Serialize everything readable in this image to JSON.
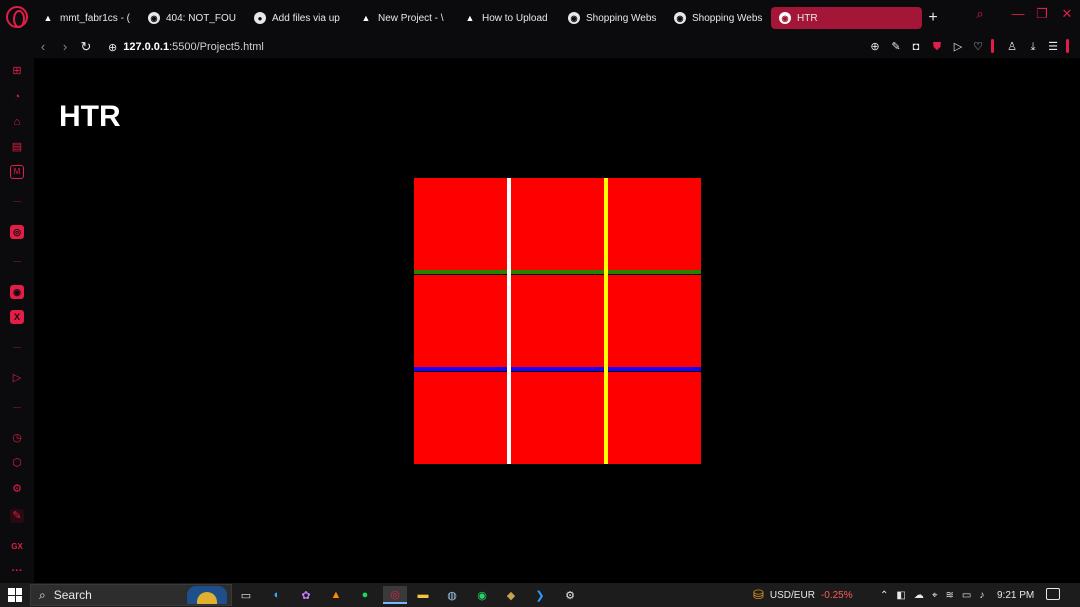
{
  "browser": {
    "tabs": [
      {
        "label": "mmt_fabr1cs - (",
        "icon": "triangle-icon"
      },
      {
        "label": "404: NOT_FOU",
        "icon": "globe-icon"
      },
      {
        "label": "Add files via up",
        "icon": "github-icon"
      },
      {
        "label": "New Project - \\",
        "icon": "triangle-icon"
      },
      {
        "label": "How to Upload",
        "icon": "triangle-icon"
      },
      {
        "label": "Shopping Webs",
        "icon": "globe-icon"
      },
      {
        "label": "Shopping Webs",
        "icon": "globe-icon"
      },
      {
        "label": "HTR",
        "icon": "globe-icon",
        "active": true
      }
    ],
    "address": {
      "host": "127.0.0.1",
      "path": ":5500/Project5.html"
    },
    "accent_color": "#e11d48"
  },
  "page": {
    "title": "HTR",
    "cube": {
      "face_color": "#ff0000",
      "grid": "3x3",
      "vertical_seams": [
        "#ffffff",
        "#ffff00"
      ],
      "horizontal_seams": [
        "#2a8000",
        "#1a00ff"
      ]
    }
  },
  "sidebar": {
    "icons": [
      "gamepad-icon",
      "speedometer-icon",
      "shopping-bag-icon",
      "tv-icon",
      "music-icon",
      "instagram-icon",
      "messenger-icon",
      "x-twitter-icon",
      "send-icon",
      "clock-icon",
      "cube-icon",
      "settings-icon",
      "pen-icon",
      "gx-icon",
      "more-icon"
    ],
    "gx_label": "GX",
    "x_label": "X",
    "more_label": "···"
  },
  "taskbar": {
    "search_placeholder": "Search",
    "currency_pair": "USD/EUR",
    "currency_change": "-0.25%",
    "time": "9:21 PM"
  }
}
